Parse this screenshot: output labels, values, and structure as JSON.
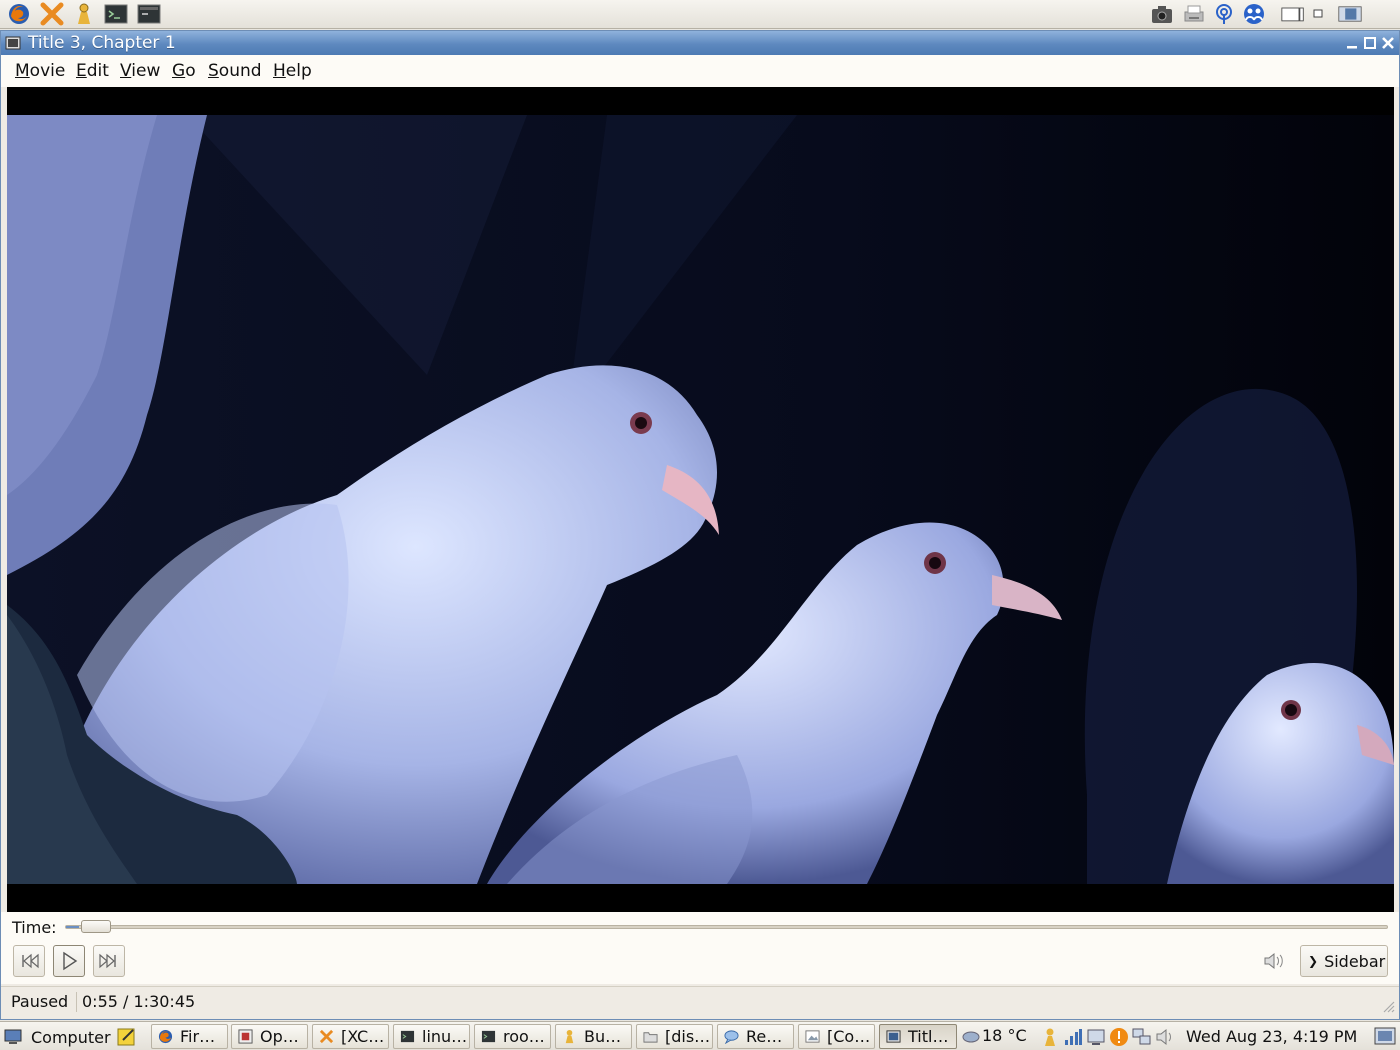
{
  "top_panel": {
    "launchers": [
      "firefox-icon",
      "xchat-icon",
      "buddy-icon",
      "terminal-icon",
      "terminal-alt-icon"
    ],
    "tray": [
      "camera-icon",
      "printer-icon",
      "network-icon",
      "people-icon",
      "workspace-switcher-icon",
      "desktop-preview-icon"
    ]
  },
  "window": {
    "title": "Title 3, Chapter 1"
  },
  "menubar": {
    "items": [
      {
        "label": "Movie",
        "accel": "M"
      },
      {
        "label": "Edit",
        "accel": "E"
      },
      {
        "label": "View",
        "accel": "V"
      },
      {
        "label": "Go",
        "accel": "G"
      },
      {
        "label": "Sound",
        "accel": "S"
      },
      {
        "label": "Help",
        "accel": "H"
      }
    ]
  },
  "player": {
    "time_label": "Time:",
    "progress_fraction": 0.01,
    "sidebar_label": "Sidebar",
    "status_state": "Paused",
    "status_time": "0:55 / 1:30:45"
  },
  "taskbar": {
    "computer_label": "Computer",
    "tasks": [
      {
        "label": "Fir…",
        "icon": "firefox-icon"
      },
      {
        "label": "Op…",
        "icon": "openoffice-icon"
      },
      {
        "label": "[XC…",
        "icon": "xchat-icon"
      },
      {
        "label": "linu…",
        "icon": "terminal-icon"
      },
      {
        "label": "roo…",
        "icon": "terminal-icon"
      },
      {
        "label": "Bu…",
        "icon": "buddy-icon"
      },
      {
        "label": "[dis…",
        "icon": "folder-icon"
      },
      {
        "label": "Re…",
        "icon": "chat-icon"
      },
      {
        "label": "[Co…",
        "icon": "image-icon"
      },
      {
        "label": "Titl…",
        "icon": "movie-icon",
        "active": true
      }
    ],
    "weather": "18 °C",
    "clock": "Wed Aug 23,  4:19 PM"
  },
  "colors": {
    "titlebar": "#5e89bf",
    "panel": "#e4e1d9",
    "video_bg": "#000000"
  }
}
